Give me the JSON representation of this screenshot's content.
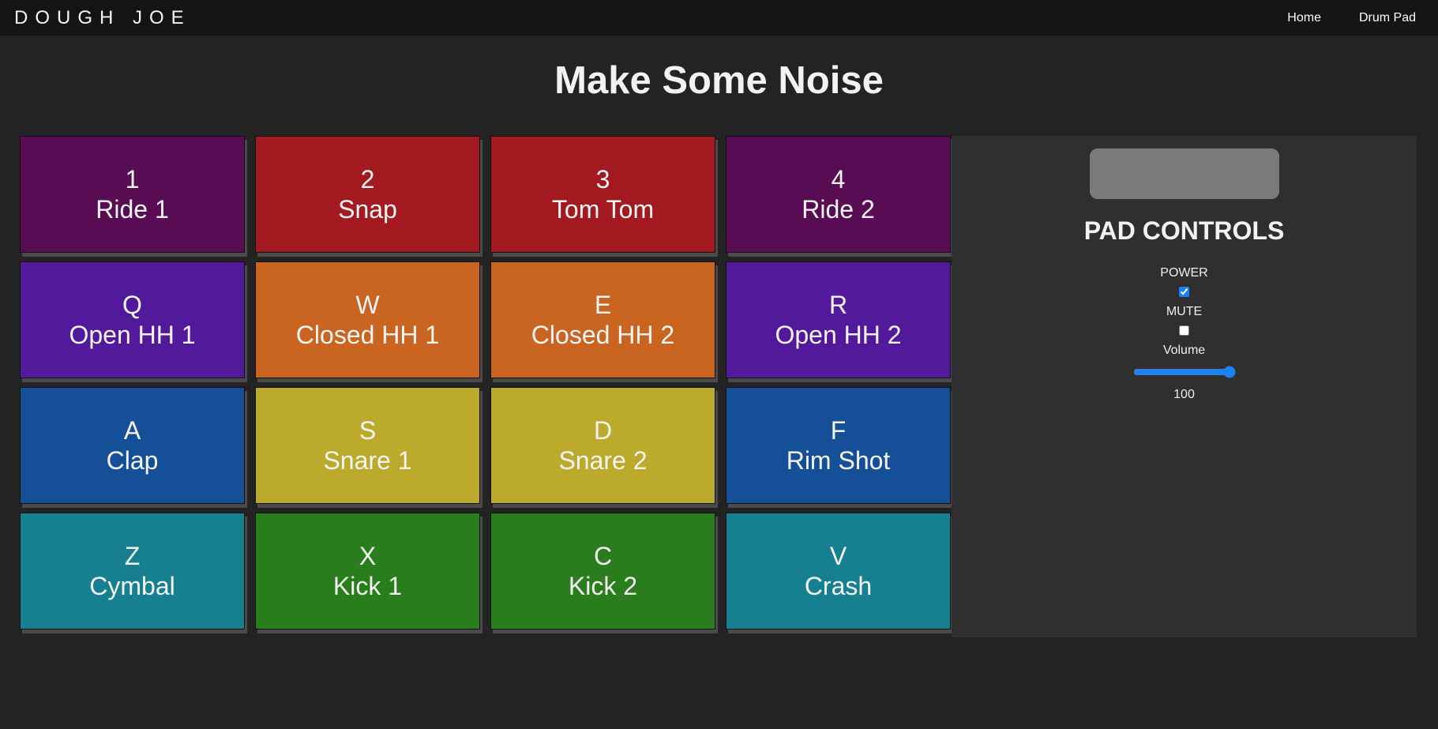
{
  "nav": {
    "brand": "DOUGH JOE",
    "links": [
      "Home",
      "Drum Pad"
    ]
  },
  "title": "Make Some Noise",
  "pads": [
    {
      "key": "1",
      "name": "Ride 1",
      "color": "#580c54"
    },
    {
      "key": "2",
      "name": "Snap",
      "color": "#a2191f"
    },
    {
      "key": "3",
      "name": "Tom Tom",
      "color": "#a2191f"
    },
    {
      "key": "4",
      "name": "Ride 2",
      "color": "#580c54"
    },
    {
      "key": "Q",
      "name": "Open HH 1",
      "color": "#53199b"
    },
    {
      "key": "W",
      "name": "Closed HH 1",
      "color": "#ca6521"
    },
    {
      "key": "E",
      "name": "Closed HH 2",
      "color": "#ca6521"
    },
    {
      "key": "R",
      "name": "Open HH 2",
      "color": "#53199b"
    },
    {
      "key": "A",
      "name": "Clap",
      "color": "#154f97"
    },
    {
      "key": "S",
      "name": "Snare 1",
      "color": "#bcaa2d"
    },
    {
      "key": "D",
      "name": "Snare 2",
      "color": "#bcaa2d"
    },
    {
      "key": "F",
      "name": "Rim Shot",
      "color": "#154f97"
    },
    {
      "key": "Z",
      "name": "Cymbal",
      "color": "#168090"
    },
    {
      "key": "X",
      "name": "Kick 1",
      "color": "#2a7d1c"
    },
    {
      "key": "C",
      "name": "Kick 2",
      "color": "#2a7d1c"
    },
    {
      "key": "V",
      "name": "Crash",
      "color": "#168090"
    }
  ],
  "controls": {
    "title": "PAD CONTROLS",
    "power_label": "POWER",
    "power_on": true,
    "mute_label": "MUTE",
    "mute_on": false,
    "volume_label": "Volume",
    "volume_value": "100",
    "accent_color": "#1a82f7"
  }
}
